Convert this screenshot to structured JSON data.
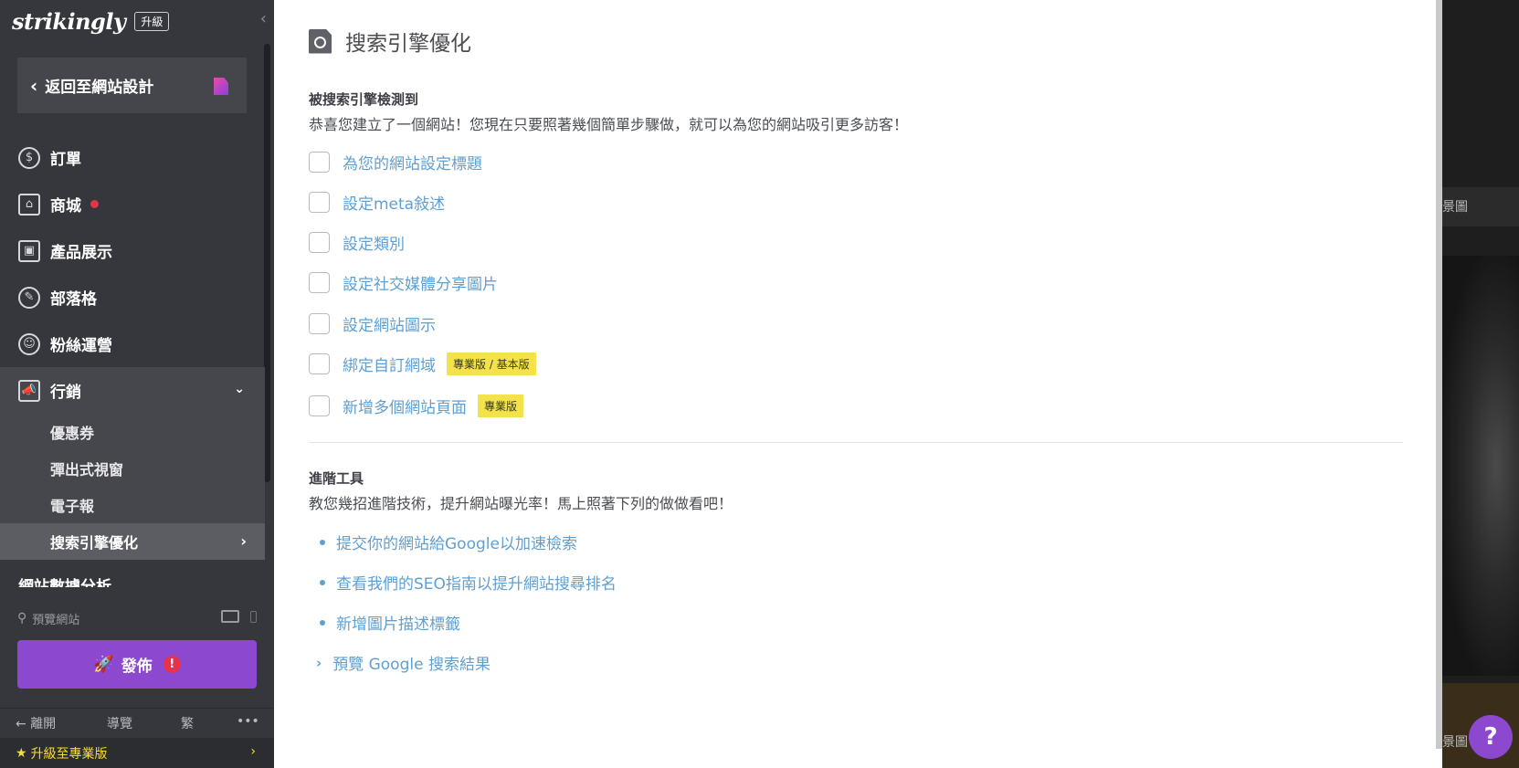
{
  "sidebar": {
    "logo": "strikingly",
    "upgrade_badge": "升級",
    "collapse_icon": "‹",
    "back_label": "返回至網站設計",
    "nav": [
      {
        "label": "訂單",
        "icon": "$"
      },
      {
        "label": "商城",
        "icon": "⌂"
      },
      {
        "label": "產品展示",
        "icon": "▣"
      },
      {
        "label": "部落格",
        "icon": "✎"
      },
      {
        "label": "粉絲運營",
        "icon": "☺"
      }
    ],
    "marketing": {
      "label": "行銷",
      "icon": "📣",
      "expand_icon": "⌄",
      "sub_items": [
        "優惠券",
        "彈出式視窗",
        "電子報",
        "搜索引擎優化"
      ],
      "active_index": 3
    },
    "cut_item": "網站數據分析",
    "preview_label": "預覽網站",
    "publish_label": "發佈",
    "publish_alert": "!",
    "bottom": {
      "leave": "離開",
      "guide": "導覽",
      "lang": "繁",
      "more": "•••"
    },
    "upgrade_pro": "升級至專業版",
    "accent": "#8c48cf",
    "highlight": "#f6dd39",
    "dot_color": "#e5334b"
  },
  "main": {
    "title": "搜索引擎優化",
    "detected": {
      "title": "被搜索引擎檢測到",
      "desc": "恭喜您建立了一個網站！您現在只要照著幾個簡單步驟做，就可以為您的網站吸引更多訪客！"
    },
    "checklist": [
      {
        "label": "為您的網站設定標題",
        "tag": ""
      },
      {
        "label": "設定meta敍述",
        "tag": ""
      },
      {
        "label": "設定類別",
        "tag": ""
      },
      {
        "label": "設定社交媒體分享圖片",
        "tag": ""
      },
      {
        "label": "設定網站圖示",
        "tag": ""
      },
      {
        "label": "綁定自訂網域",
        "tag": "專業版 / 基本版"
      },
      {
        "label": "新增多個網站頁面",
        "tag": "專業版"
      }
    ],
    "advanced": {
      "title": "進階工具",
      "desc": "教您幾招進階技術，提升網站曝光率！馬上照著下列的做做看吧！",
      "links": [
        "提交你的網站給Google以加速檢索",
        "查看我們的SEO指南以提升網站搜尋排名",
        "新增圖片描述標籤"
      ],
      "preview_google": "預覽 Google 搜索結果"
    },
    "link_color": "#5f9fd1",
    "tag_color": "#f4e24b"
  },
  "preview_strip": {
    "label_top": "景圖",
    "label_bottom": "景圖"
  },
  "help_label": "?"
}
